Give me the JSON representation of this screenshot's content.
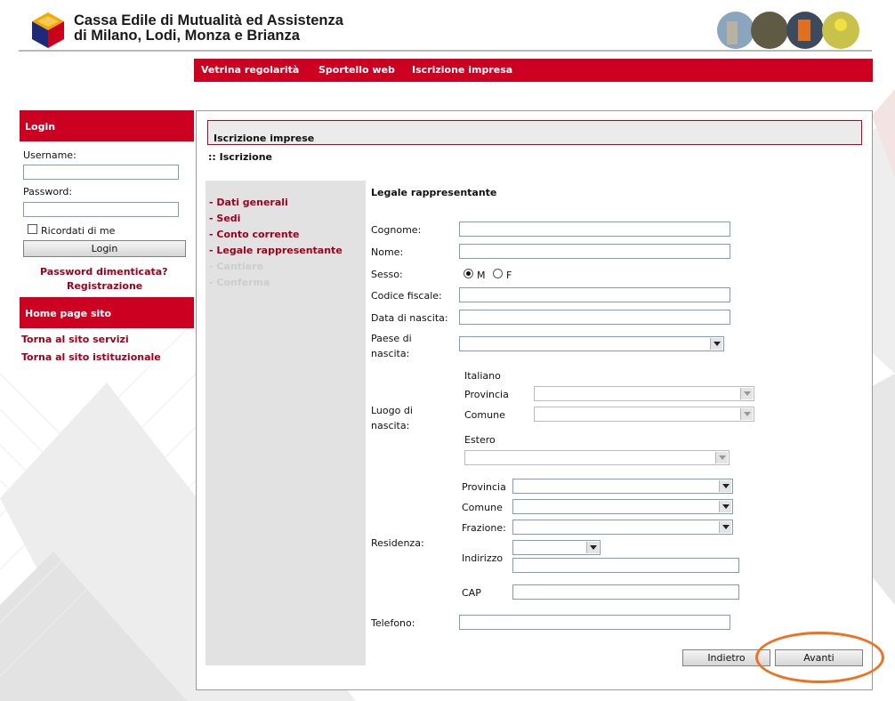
{
  "header": {
    "title_line1": "Cassa Edile di Mutualità ed Assistenza",
    "title_line2": "di Milano, Lodi, Monza e Brianza"
  },
  "topnav": {
    "items": [
      "Vetrina regolarità",
      "Sportello web",
      "Iscrizione impresa"
    ]
  },
  "sidebar": {
    "login_heading": "Login",
    "username_label": "Username:",
    "username_value": "",
    "password_label": "Password:",
    "password_value": "",
    "remember_label": "Ricordati di me",
    "login_button": "Login",
    "forgot_link": "Password dimenticata?",
    "register_link": "Registrazione",
    "home_heading": "Home page sito",
    "home_links": [
      "Torna al sito servizi",
      "Torna al sito istituzionale"
    ]
  },
  "panel": {
    "title": "Iscrizione imprese",
    "breadcrumb": ":: Iscrizione"
  },
  "steps": [
    {
      "label": "- Dati generali",
      "enabled": true
    },
    {
      "label": "- Sedi",
      "enabled": true
    },
    {
      "label": "- Conto corrente",
      "enabled": true
    },
    {
      "label": "- Legale rappresentante",
      "enabled": true
    },
    {
      "label": "- Cantiere",
      "enabled": false
    },
    {
      "label": "- Conferma",
      "enabled": false
    }
  ],
  "form": {
    "section_title": "Legale rappresentante",
    "cognome_label": "Cognome:",
    "cognome_value": "",
    "nome_label": "Nome:",
    "nome_value": "",
    "sesso_label": "Sesso:",
    "sesso_options": [
      "M",
      "F"
    ],
    "sesso_selected": "M",
    "codice_fiscale_label": "Codice fiscale:",
    "codice_fiscale_value": "",
    "data_nascita_label": "Data di nascita:",
    "data_nascita_value": "",
    "paese_nascita_label_1": "Paese di",
    "paese_nascita_label_2": "nascita:",
    "paese_nascita_value": "",
    "luogo_nascita_label_1": "Luogo di",
    "luogo_nascita_label_2": "nascita:",
    "italiano_label": "Italiano",
    "provincia_label": "Provincia",
    "comune_label": "Comune",
    "estero_label": "Estero",
    "residenza_label": "Residenza:",
    "res_provincia_label": "Provincia",
    "res_comune_label": "Comune",
    "frazione_label": "Frazione:",
    "indirizzo_label": "Indirizzo",
    "indirizzo_value": "",
    "cap_label": "CAP",
    "cap_value": "",
    "telefono_label": "Telefono:",
    "telefono_value": ""
  },
  "buttons": {
    "back": "Indietro",
    "next": "Avanti"
  },
  "colors": {
    "brand_red": "#cc0020",
    "link_red": "#a0001c",
    "highlight_orange": "#f07020"
  }
}
